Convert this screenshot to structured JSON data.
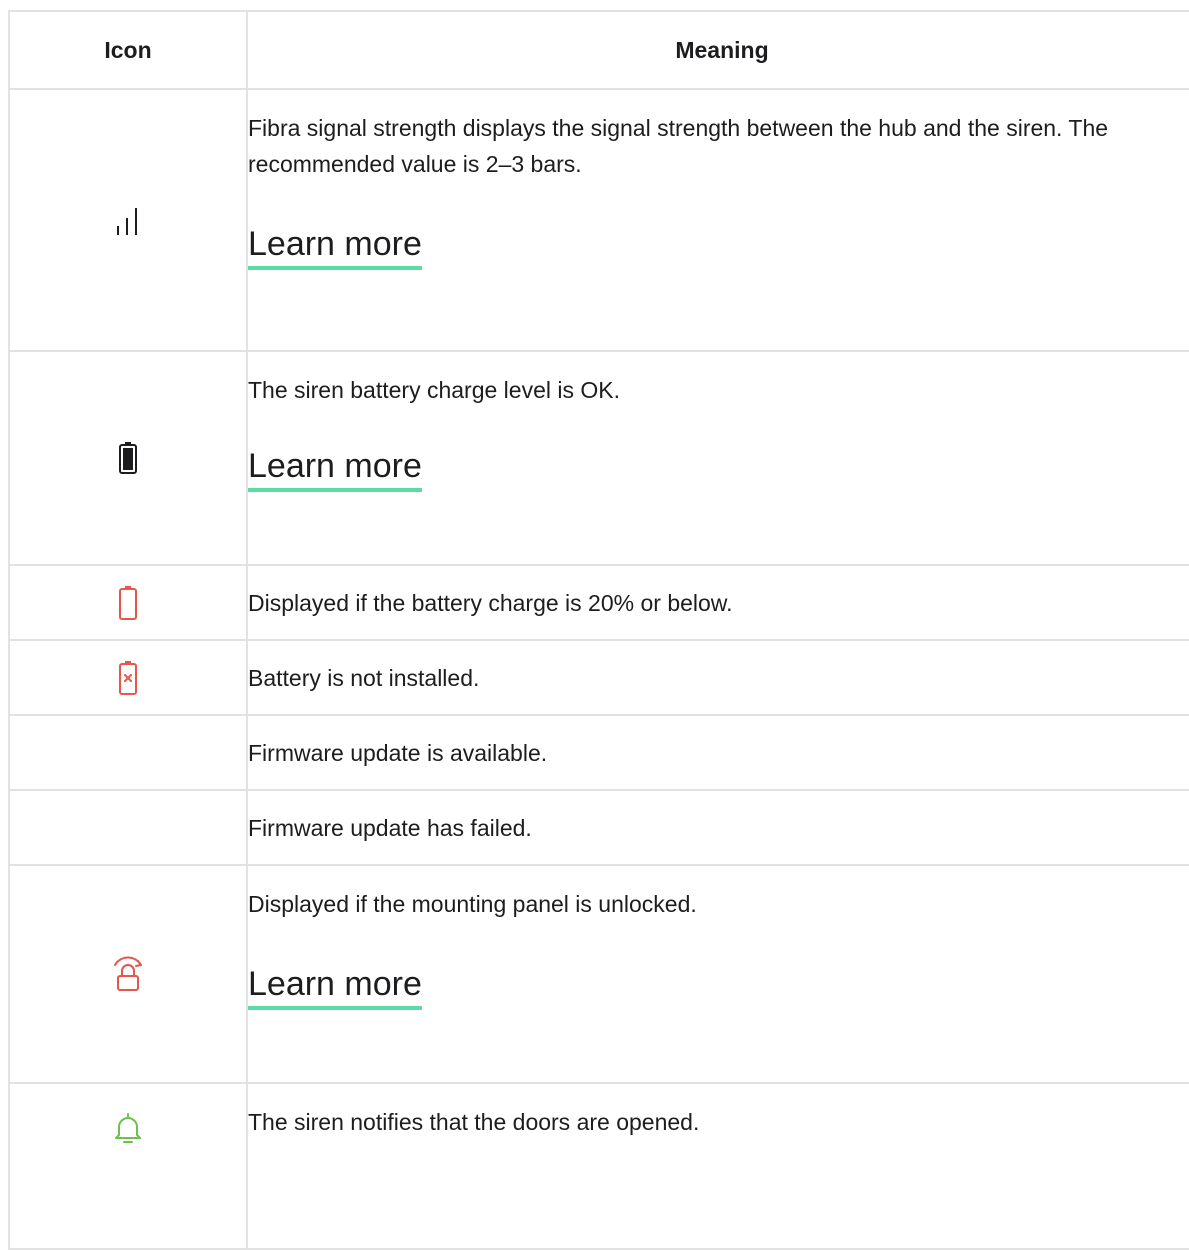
{
  "table": {
    "headers": {
      "icon": "Icon",
      "meaning": "Meaning"
    },
    "rows": [
      {
        "icon": "signal-strength-icon",
        "text": "Fibra signal strength displays the signal strength between the hub and the siren. The recommended value is 2–3 bars.",
        "link": "Learn more"
      },
      {
        "icon": "battery-full-icon",
        "text": "The siren battery charge level is OK.",
        "link": "Learn more"
      },
      {
        "icon": "battery-low-icon",
        "text": "Displayed if the battery charge is 20% or below."
      },
      {
        "icon": "battery-missing-icon",
        "text": "Battery is not installed."
      },
      {
        "icon": "",
        "text": "Firmware update is available."
      },
      {
        "icon": "",
        "text": "Firmware update has failed."
      },
      {
        "icon": "lid-unlocked-icon",
        "text": "Displayed if the mounting panel is unlocked.",
        "link": "Learn more"
      },
      {
        "icon": "bell-icon",
        "text": "The siren notifies that the doors are opened."
      }
    ]
  },
  "colors": {
    "link_underline": "#5cdca5",
    "alert_red": "#e4574a",
    "bell_green": "#6cc24a",
    "border": "#e2e2e2"
  }
}
